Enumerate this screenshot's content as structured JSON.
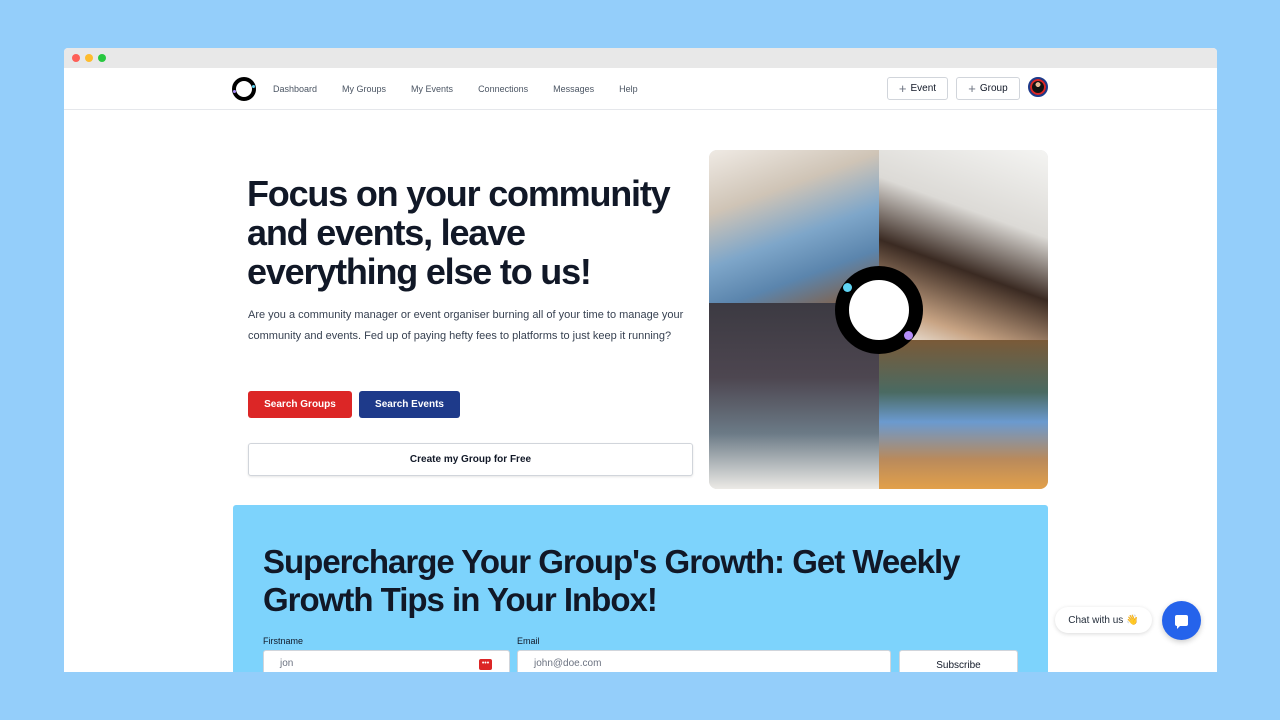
{
  "nav": {
    "links": [
      "Dashboard",
      "My Groups",
      "My Events",
      "Connections",
      "Messages",
      "Help"
    ],
    "event_button": "Event",
    "group_button": "Group",
    "plus_glyph": "+"
  },
  "hero": {
    "title": "Focus on your community and events, leave everything else to us!",
    "description": "Are you a community manager or event organiser burning all of your time to manage your community and events. Fed up of paying hefty fees to platforms to just keep it running?",
    "search_groups": "Search Groups",
    "search_events": "Search Events",
    "create_group": "Create my Group for Free"
  },
  "newsletter": {
    "title": "Supercharge Your Group's Growth: Get Weekly Growth Tips in Your Inbox!",
    "firstname_label": "Firstname",
    "firstname_placeholder": "jon",
    "email_label": "Email",
    "email_placeholder": "john@doe.com",
    "subscribe": "Subscribe",
    "password_manager_glyph": "•••"
  },
  "chat": {
    "label": "Chat with us",
    "emoji": "👋"
  },
  "colors": {
    "primary_red": "#dc2626",
    "primary_blue": "#1e3a8a",
    "newsletter_bg": "#7dd3fc",
    "chat_blue": "#2563eb"
  }
}
